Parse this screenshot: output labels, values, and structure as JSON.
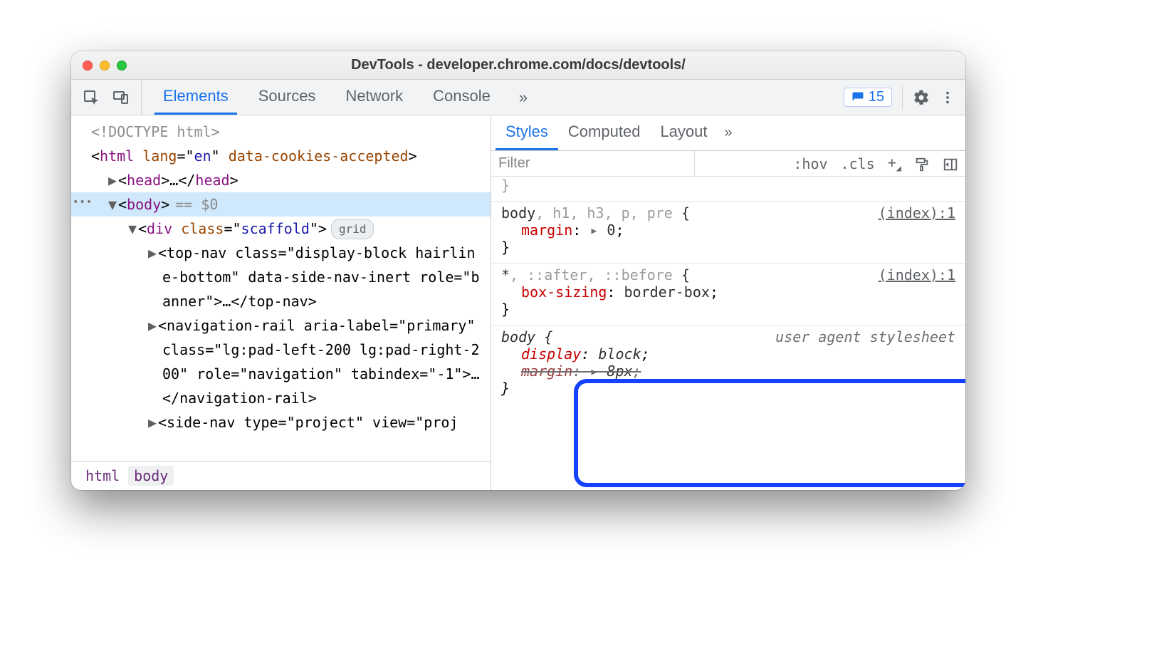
{
  "window_title": "DevTools - developer.chrome.com/docs/devtools/",
  "main_tabs": {
    "items": [
      "Elements",
      "Sources",
      "Network",
      "Console"
    ],
    "active_index": 0,
    "overflow": "»"
  },
  "issues": {
    "count": "15"
  },
  "dom": {
    "doctype": "<!DOCTYPE html>",
    "html_open": [
      "html",
      "lang",
      "en",
      "data-cookies-accepted"
    ],
    "head": [
      "head",
      "…"
    ],
    "body_eq": "== $0",
    "scaffold": [
      "div",
      "class",
      "scaffold",
      "grid"
    ],
    "topnav_a": "<top-nav class=\"display-block hairlin",
    "topnav_b": "e-bottom\" data-side-nav-inert role=\"b",
    "topnav_c": "anner\">…</top-nav>",
    "navr_a": "<navigation-rail aria-label=\"primary\"",
    "navr_b": "class=\"lg:pad-left-200 lg:pad-right-2",
    "navr_c": "00\" role=\"navigation\" tabindex=\"-1\">…",
    "navr_d": "</navigation-rail>",
    "sidenav": "<side-nav type=\"project\" view=\"proj"
  },
  "breadcrumbs": [
    "html",
    "body"
  ],
  "sub_tabs": {
    "items": [
      "Styles",
      "Computed",
      "Layout"
    ],
    "active_index": 0,
    "overflow": "»"
  },
  "filter": {
    "placeholder": "Filter",
    "hov": ":hov",
    "cls": ".cls",
    "plus": "+"
  },
  "rules": [
    {
      "selector_main": "body",
      "selector_dim": ", h1, h3, p, pre",
      "brace_open": " {",
      "source": "(index):1",
      "decls": [
        {
          "prop": "margin",
          "arrow": true,
          "val": "0",
          "struck": false
        }
      ],
      "brace_close": "}"
    },
    {
      "selector_main": "*",
      "selector_dim": ", ::after, ::before",
      "brace_open": " {",
      "source": "(index):1",
      "decls": [
        {
          "prop": "box-sizing",
          "arrow": false,
          "val": "border-box",
          "struck": false
        }
      ],
      "brace_close": "}"
    },
    {
      "ua": true,
      "selector_main": "body",
      "selector_dim": "",
      "brace_open": " {",
      "source": "user agent stylesheet",
      "decls": [
        {
          "prop": "display",
          "arrow": false,
          "val": "block",
          "struck": false
        },
        {
          "prop": "margin",
          "arrow": true,
          "val": "8px",
          "struck": true
        }
      ],
      "brace_close": "}"
    }
  ]
}
